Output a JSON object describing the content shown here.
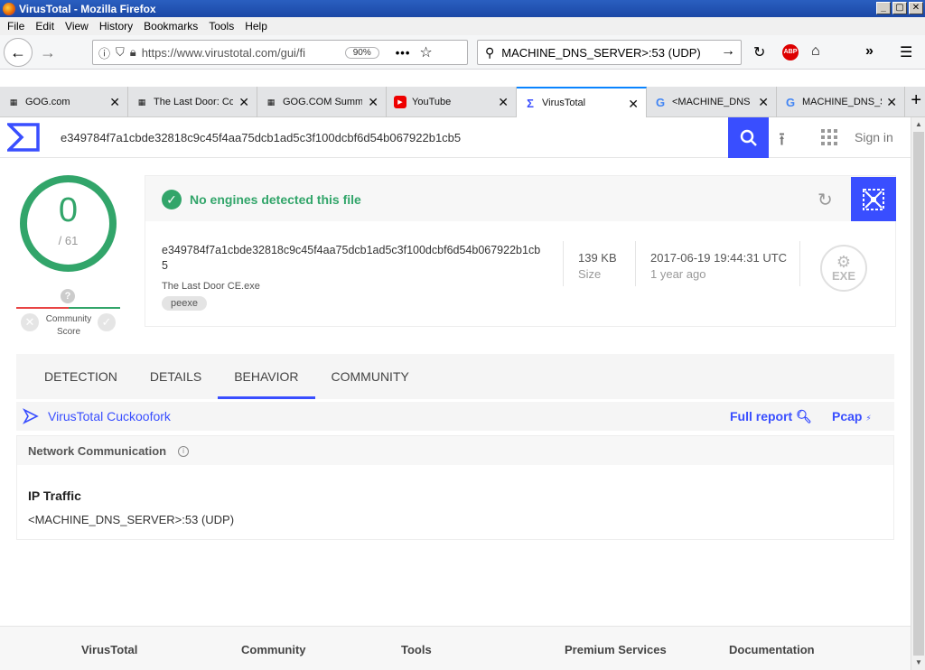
{
  "window": {
    "title": "VirusTotal - Mozilla Firefox",
    "min": "_",
    "max": "▢",
    "close": "✕"
  },
  "menubar": {
    "items": [
      "File",
      "Edit",
      "View",
      "History",
      "Bookmarks",
      "Tools",
      "Help"
    ]
  },
  "navbar": {
    "url": "https://www.virustotal.com/gui/fi",
    "zoom": "90%",
    "search_value": "MACHINE_DNS_SERVER>:53 (UDP)"
  },
  "tabs": [
    {
      "label": "GOG.com",
      "icon": "gog-icon"
    },
    {
      "label": "The Last Door: Co",
      "icon": "gog-icon"
    },
    {
      "label": "GOG.COM Summe",
      "icon": "gog-icon"
    },
    {
      "label": "YouTube",
      "icon": "youtube-icon"
    },
    {
      "label": "VirusTotal",
      "icon": "virustotal-icon",
      "active": true
    },
    {
      "label": "<MACHINE_DNS",
      "icon": "google-icon"
    },
    {
      "label": "MACHINE_DNS_S",
      "icon": "google-icon"
    }
  ],
  "vt": {
    "hash": "e349784f7a1cbde32818c9c45f4aa75dcb1ad5c3f100dcbf6d54b067922b1cb5",
    "sign_in": "Sign in",
    "score": "0",
    "score_total": "/ 61",
    "community_label": "Community Score",
    "detection_msg": "No engines detected this file",
    "file_hash": "e349784f7a1cbde32818c9c45f4aa75dcb1ad5c3f100dcbf6d54b067922b1cb5",
    "file_name": "The Last Door CE.exe",
    "file_tag": "peexe",
    "size": "139 KB",
    "size_label": "Size",
    "date": "2017-06-19 19:44:31 UTC",
    "date_rel": "1 year ago",
    "filetype": "EXE",
    "nav_tabs": [
      "DETECTION",
      "DETAILS",
      "BEHAVIOR",
      "COMMUNITY"
    ],
    "active_tab": "BEHAVIOR",
    "sandbox": "VirusTotal Cuckoofork",
    "full_report": "Full report",
    "pcap": "Pcap",
    "net_title": "Network Communication",
    "ip_title": "IP Traffic",
    "ip_value": "<MACHINE_DNS_SERVER>:53 (UDP)",
    "footer": [
      "VirusTotal",
      "Community",
      "Tools",
      "Premium Services",
      "Documentation"
    ],
    "colors": {
      "accent": "#394eff",
      "ok": "#32a56a"
    }
  }
}
